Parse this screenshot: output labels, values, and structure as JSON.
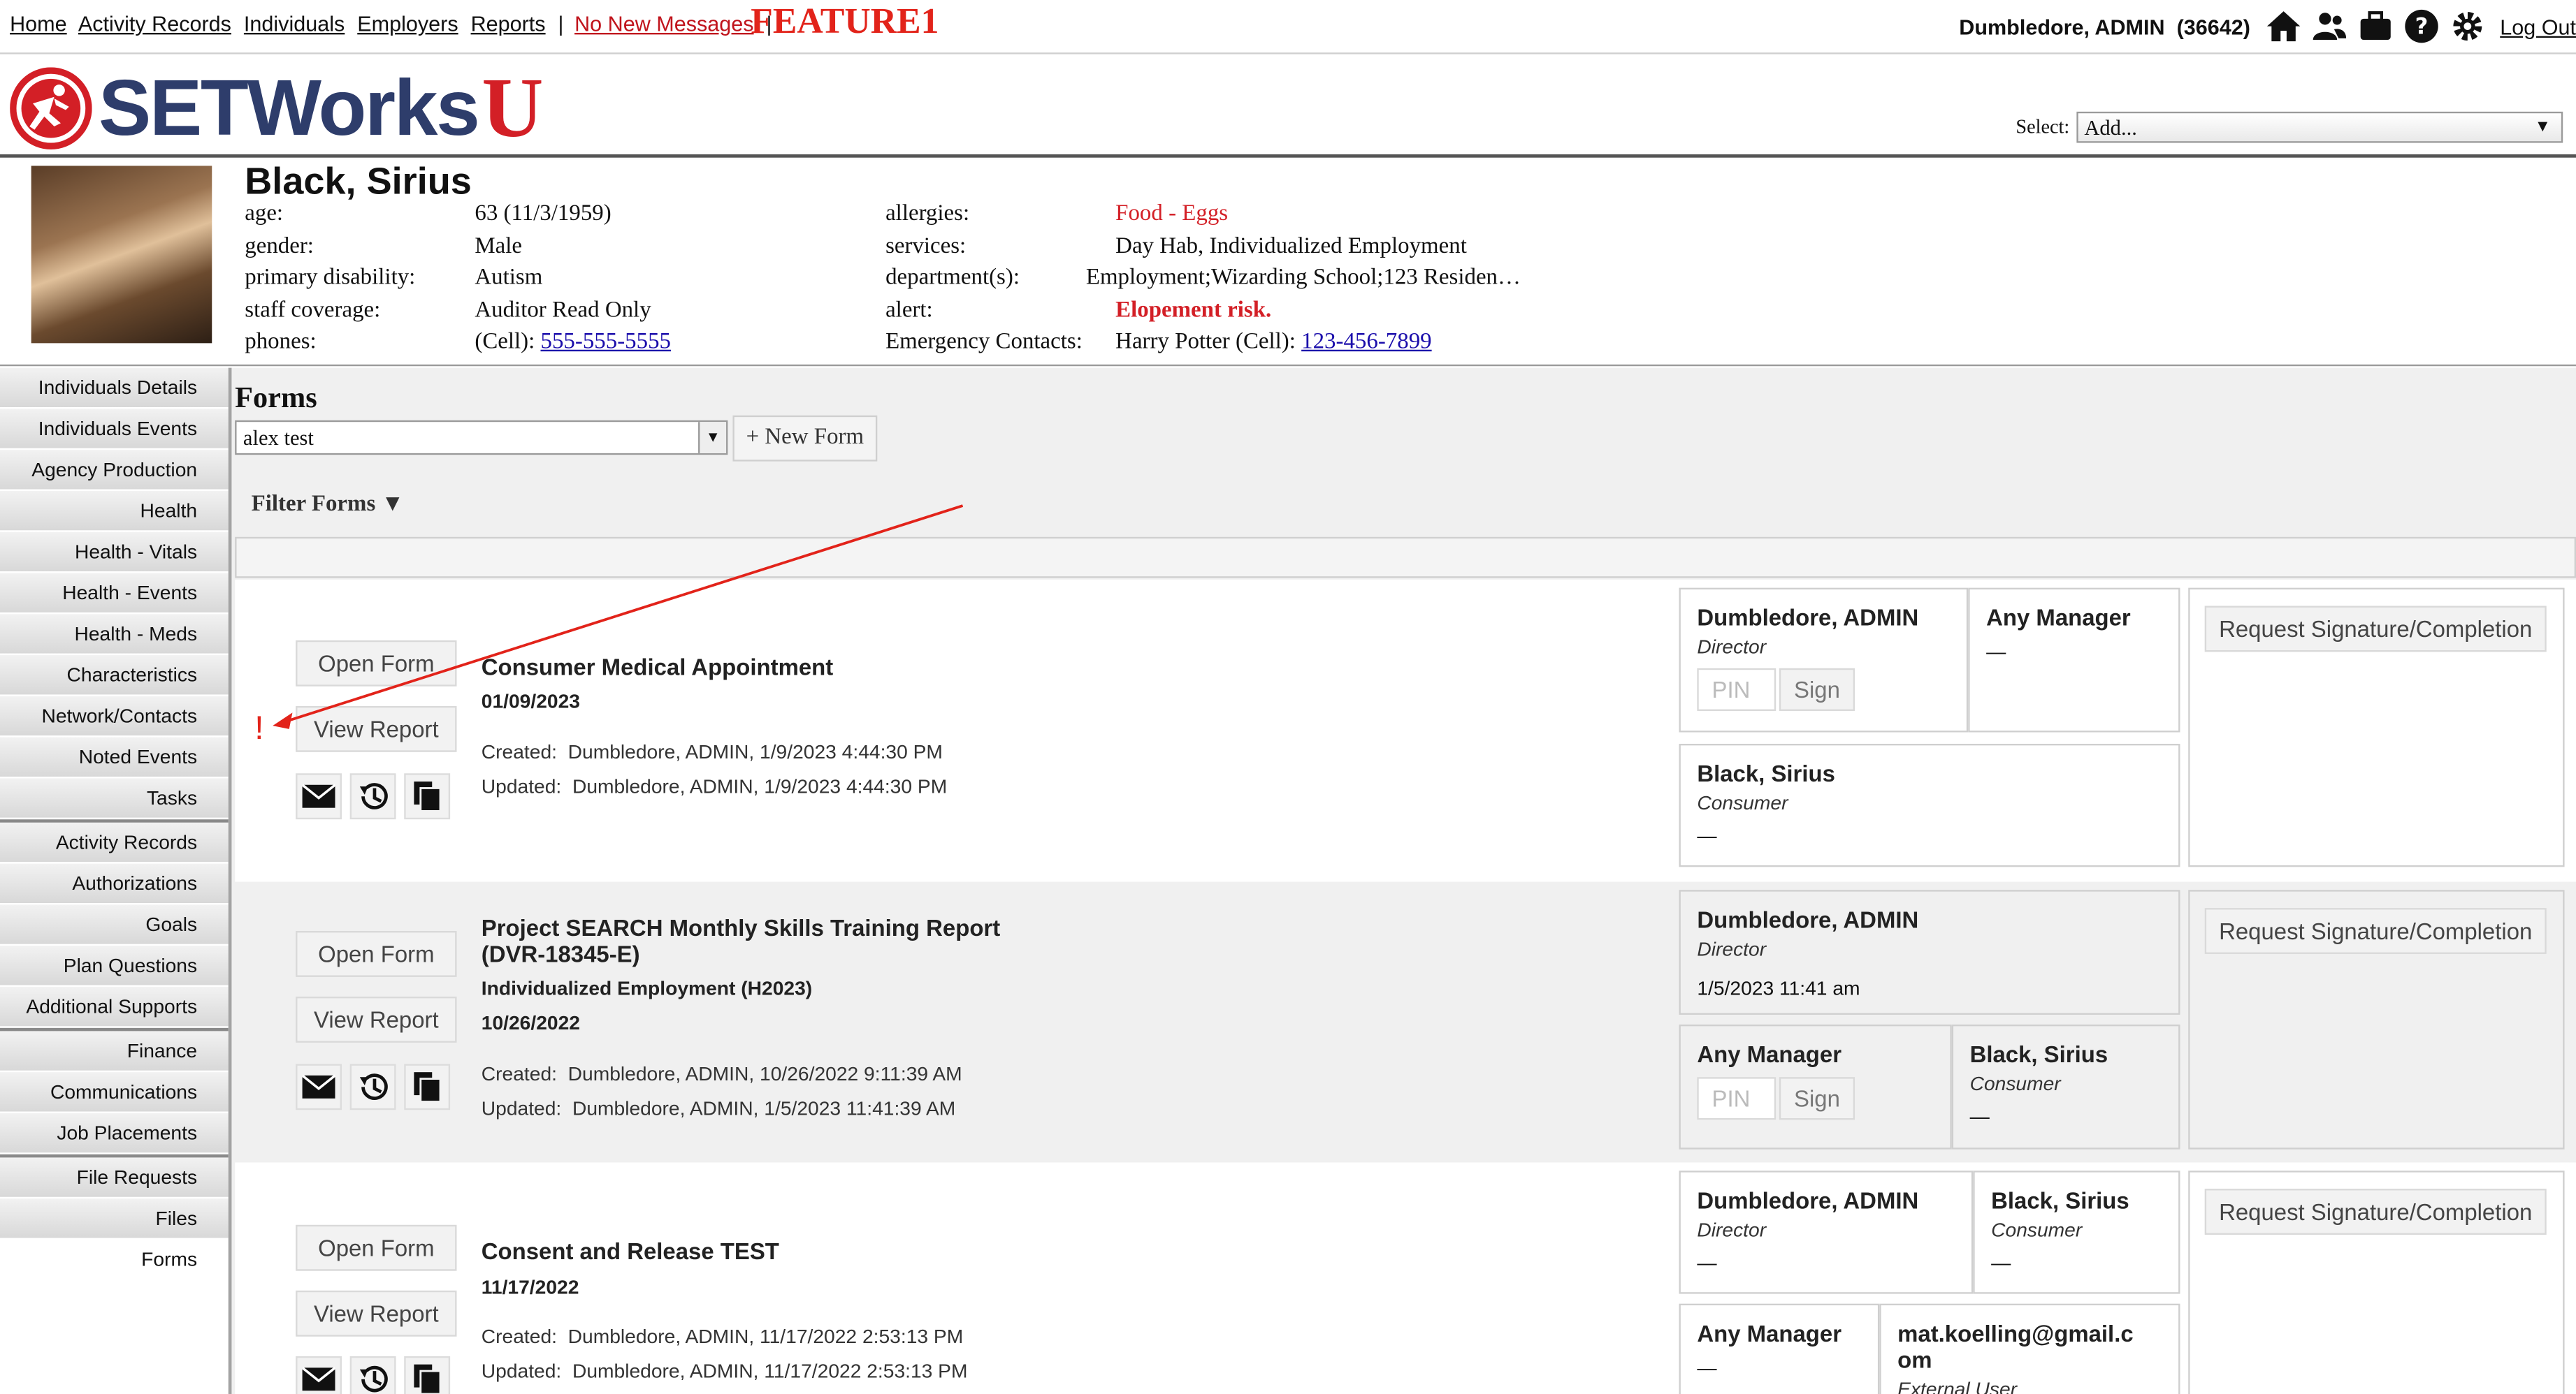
{
  "topnav": {
    "links": [
      "Home",
      "Activity Records",
      "Individuals",
      "Employers",
      "Reports"
    ],
    "messages": "No New Messages",
    "feature": "FEATURE1",
    "user": "Dumbledore, ADMIN",
    "user_id": "(36642)",
    "icons": [
      "home-icon",
      "users-icon",
      "briefcase-icon",
      "help-icon",
      "gear-icon"
    ],
    "logout": "Log Out"
  },
  "logo": {
    "text": "SETWorks",
    "suffix": "U"
  },
  "header_select": {
    "label": "Select:",
    "value": "Add..."
  },
  "person": {
    "name": "Black, Sirius",
    "left_labels": [
      "age:",
      "gender:",
      "primary disability:",
      "staff coverage:",
      "phones:"
    ],
    "age": "63 (11/3/1959)",
    "gender": "Male",
    "disability": "Autism",
    "coverage": "Auditor Read Only",
    "phone_prefix": "(Cell): ",
    "phone": "555-555-5555",
    "right_labels": [
      "allergies:",
      "services:",
      "department(s):",
      "alert:",
      "Emergency Contacts:"
    ],
    "allergies": "Food - Eggs",
    "services": "Day Hab, Individualized Employment",
    "departments": "Employment;Wizarding School;123 Residen…",
    "alert": "Elopement risk.",
    "emergency_prefix": "Harry Potter (Cell): ",
    "emergency_phone": "123-456-7899"
  },
  "sidebar": [
    "Individuals Details",
    "Individuals Events",
    "Agency Production",
    "Health",
    "Health - Vitals",
    "Health - Events",
    "Health - Meds",
    "Characteristics",
    "Network/Contacts",
    "Noted Events",
    "Tasks",
    "Activity Records",
    "Authorizations",
    "Goals",
    "Plan Questions",
    "Additional Supports",
    "Finance",
    "Communications",
    "Job Placements",
    "File Requests",
    "Files",
    "Forms"
  ],
  "forms": {
    "title": "Forms",
    "selected_form": "alex test",
    "new_form": "+ New Form",
    "filter": "Filter Forms ▼",
    "open_label": "Open Form",
    "view_label": "View Report",
    "request_label": "Request Signature/Completion",
    "pin_placeholder": "PIN",
    "sign_label": "Sign",
    "warning": "!",
    "items": [
      {
        "title": "Consumer Medical Appointment",
        "date": "01/09/2023",
        "created_label": "Created:",
        "created": "Dumbledore, ADMIN, 1/9/2023 4:44:30 PM",
        "updated_label": "Updated:",
        "updated": "Dumbledore, ADMIN, 1/9/2023 4:44:30 PM",
        "signers": [
          {
            "name": "Dumbledore, ADMIN",
            "role": "Director"
          },
          {
            "name": "Any Manager",
            "dash": "—"
          },
          {
            "name": "Black, Sirius",
            "role": "Consumer",
            "dash": "—"
          }
        ]
      },
      {
        "title": "Project SEARCH Monthly Skills Training Report",
        "title2": "(DVR-18345-E)",
        "service": "Individualized Employment (H2023)",
        "date": "10/26/2022",
        "created_label": "Created:",
        "created": "Dumbledore, ADMIN, 10/26/2022 9:11:39 AM",
        "updated_label": "Updated:",
        "updated": "Dumbledore, ADMIN, 1/5/2023 11:41:39 AM",
        "signers": [
          {
            "name": "Dumbledore, ADMIN",
            "role": "Director",
            "date": "1/5/2023 11:41 am"
          },
          {
            "name": "Any Manager"
          },
          {
            "name": "Black, Sirius",
            "role": "Consumer",
            "dash": "—"
          }
        ]
      },
      {
        "title": "Consent and Release TEST",
        "date": "11/17/2022",
        "created_label": "Created:",
        "created": "Dumbledore, ADMIN, 11/17/2022 2:53:13 PM",
        "updated_label": "Updated:",
        "updated": "Dumbledore, ADMIN, 11/17/2022 2:53:13 PM",
        "signers": [
          {
            "name": "Dumbledore, ADMIN",
            "role": "Director",
            "dash": "—"
          },
          {
            "name": "Black, Sirius",
            "role": "Consumer",
            "dash": "—"
          },
          {
            "name": "Any Manager",
            "dash": "—"
          },
          {
            "name": "mat.koelling@gmail.c",
            "name2": "om",
            "role": "External User"
          }
        ]
      }
    ]
  },
  "colors": {
    "accent_red": "#d31f26",
    "logo_blue": "#2e3d6b",
    "link_blue": "#1a0dab"
  }
}
